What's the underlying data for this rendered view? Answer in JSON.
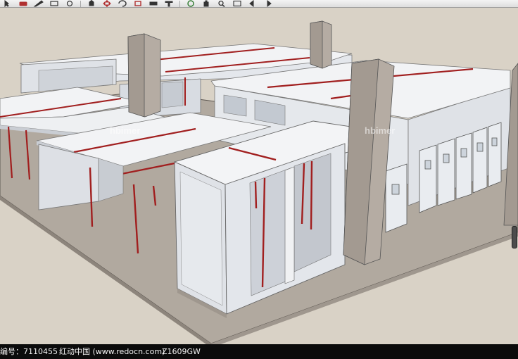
{
  "toolbar": {
    "tools": [
      {
        "name": "select-icon",
        "color": "#333333"
      },
      {
        "name": "eraser-icon",
        "color": "#b03030"
      },
      {
        "name": "pencil-icon",
        "color": "#333333"
      },
      {
        "name": "rectangle-icon",
        "color": "#333333"
      },
      {
        "name": "circle-icon",
        "color": "#333333"
      },
      {
        "name": "push-pull-icon",
        "color": "#333333"
      },
      {
        "name": "move-icon",
        "color": "#b03030"
      },
      {
        "name": "rotate-icon",
        "color": "#333333"
      },
      {
        "name": "offset-icon",
        "color": "#b03030"
      },
      {
        "name": "tape-icon",
        "color": "#333333"
      },
      {
        "name": "text-icon",
        "color": "#333333"
      },
      {
        "name": "orbit-icon",
        "color": "#2f7a2f"
      },
      {
        "name": "pan-icon",
        "color": "#333333"
      },
      {
        "name": "zoom-icon",
        "color": "#333333"
      },
      {
        "name": "zoom-extents-icon",
        "color": "#333333"
      },
      {
        "name": "previous-view-icon",
        "color": "#333333"
      },
      {
        "name": "next-view-icon",
        "color": "#333333"
      }
    ]
  },
  "viewport": {
    "watermarks": [
      "hbimer",
      "hbimer"
    ],
    "colors": {
      "background": "#d9d2c6",
      "ground": "#b1a99f",
      "wall": "#e2e5ea",
      "roof": "#f0f1f3",
      "pillar": "#a39a91",
      "accent_red": "#a11f1f"
    }
  },
  "statusbar": {
    "id_text": "编号：7110455",
    "site_text": "红动中国 (www.redocn.com)",
    "code_text": "Z1609GW"
  }
}
